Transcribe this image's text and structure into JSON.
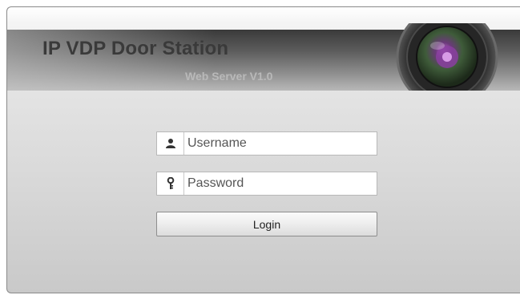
{
  "header": {
    "title": "IP VDP Door Station",
    "subtitle": "Web Server V1.0",
    "logo_icon": "camera-lens-icon"
  },
  "login_form": {
    "username": {
      "placeholder": "Username",
      "value": "",
      "icon": "user-icon"
    },
    "password": {
      "placeholder": "Password",
      "value": "",
      "icon": "key-icon"
    },
    "login_label": "Login"
  },
  "colors": {
    "header_dark": "#3a3a3a",
    "title_text": "#3a3a3a",
    "subtitle_text": "#b9b9b9",
    "lens_center": "#8a3fa0"
  }
}
